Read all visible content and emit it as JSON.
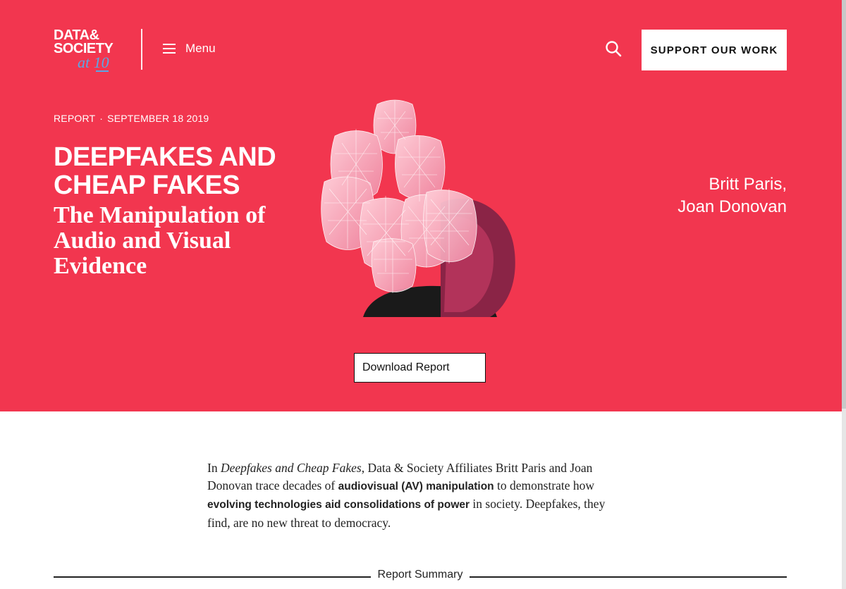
{
  "header": {
    "logo": {
      "line1": "DATA&",
      "line2": "SOCIETY",
      "line3": "at 10"
    },
    "menu_label": "Menu",
    "support_label": "SUPPORT OUR WORK",
    "icons": {
      "menu": "hamburger-icon",
      "search": "search-icon"
    }
  },
  "hero": {
    "type_label": "REPORT",
    "separator": "·",
    "date": "SEPTEMBER 18 2019",
    "title": "DEEPFAKES AND CHEAP FAKES",
    "subtitle": "The Manipulation of Audio and Visual Evidence",
    "authors": [
      "Britt Paris,",
      "Joan Donovan"
    ],
    "download_label": "Download Report"
  },
  "intro": {
    "p1": "In ",
    "report_title": "Deepfakes and Cheap Fakes",
    "p2": ", Data & Society Affiliates Britt Paris and Joan Donovan trace decades of ",
    "b1": "audiovisual (AV) manipulation",
    "p3": " to demonstrate how ",
    "b2": "evolving technologies aid consolidations of power",
    "p4": " in society. Deepfakes, they find, are no new threat to democracy."
  },
  "section_label": "Report Summary",
  "colors": {
    "brand_red": "#f2364f",
    "logo_blue": "#5aa8e6",
    "text": "#222222"
  }
}
